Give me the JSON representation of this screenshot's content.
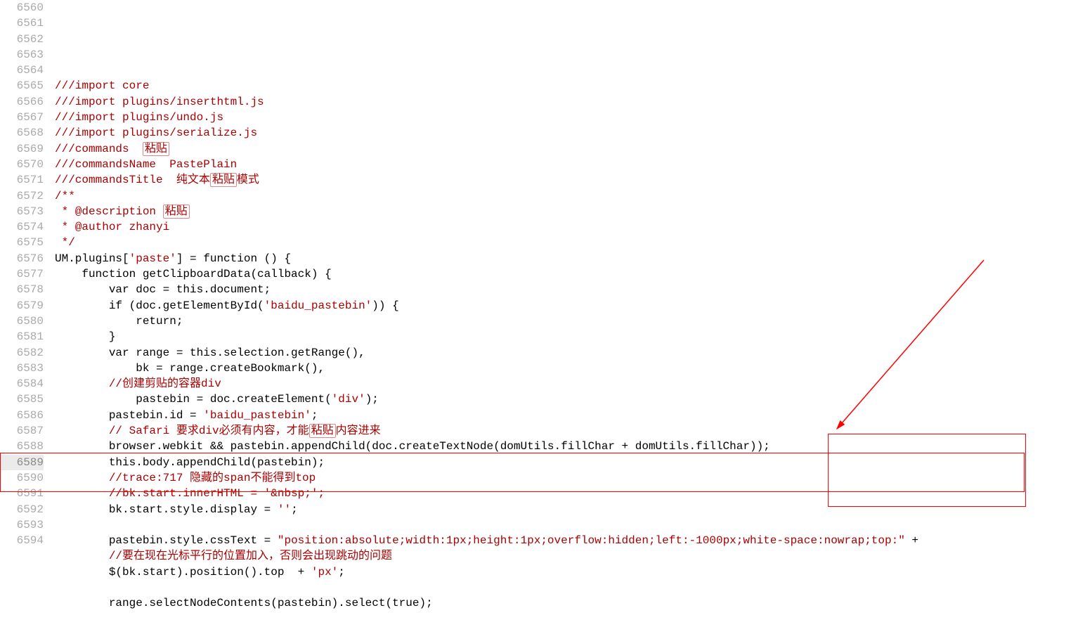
{
  "lines": [
    {
      "n": "6560",
      "t": "///import core",
      "cls": "c-com"
    },
    {
      "n": "6561",
      "t": "///import plugins/inserthtml.js",
      "cls": "c-com"
    },
    {
      "n": "6562",
      "t": "///import plugins/undo.js",
      "cls": "c-com"
    },
    {
      "n": "6563",
      "t": "///import plugins/serialize.js",
      "cls": "c-com"
    },
    {
      "n": "6564",
      "t": "///commands  ",
      "cls": "c-com",
      "suffix_boxed": "粘贴"
    },
    {
      "n": "6565",
      "t": "///commandsName  PastePlain",
      "cls": "c-com"
    },
    {
      "n": "6566",
      "t": "///commandsTitle  纯文本",
      "cls": "c-com",
      "suffix_boxed": "粘贴",
      "suffix_plain": "模式"
    },
    {
      "n": "6567",
      "t": "/**",
      "cls": "c-com"
    },
    {
      "n": "6568",
      "t": " * @description ",
      "cls": "c-com",
      "suffix_boxed": "粘贴"
    },
    {
      "n": "6569",
      "t": " * @author zhanyi",
      "cls": "c-com"
    },
    {
      "n": "6570",
      "t": " */",
      "cls": "c-com"
    },
    {
      "n": "6571",
      "code": "UM.plugins['paste'] = function () {"
    },
    {
      "n": "6572",
      "code": "    function getClipboardData(callback) {"
    },
    {
      "n": "6573",
      "code": "        var doc = this.document;"
    },
    {
      "n": "6574",
      "code": "        if (doc.getElementById('baidu_pastebin')) {"
    },
    {
      "n": "6575",
      "code": "            return;"
    },
    {
      "n": "6576",
      "code": "        }"
    },
    {
      "n": "6577",
      "code": "        var range = this.selection.getRange(),"
    },
    {
      "n": "6578",
      "code": "            bk = range.createBookmark(),"
    },
    {
      "n": "6579",
      "t": "        //创建剪贴的容器div",
      "cls": "c-com"
    },
    {
      "n": "6580",
      "code": "            pastebin = doc.createElement('div');"
    },
    {
      "n": "6581",
      "code": "        pastebin.id = 'baidu_pastebin';"
    },
    {
      "n": "6582",
      "t": "        // Safari 要求div必须有内容，才能",
      "cls": "c-com",
      "suffix_boxed": "粘贴",
      "suffix_plain": "内容进来"
    },
    {
      "n": "6583",
      "code": "        browser.webkit && pastebin.appendChild(doc.createTextNode(domUtils.fillChar + domUtils.fillChar));"
    },
    {
      "n": "6584",
      "code": "        this.body.appendChild(pastebin);"
    },
    {
      "n": "6585",
      "t": "        //trace:717 隐藏的span不能得到top",
      "cls": "c-com"
    },
    {
      "n": "6586",
      "t": "        //bk.start.innerHTML = '&nbsp;';",
      "cls": "c-com"
    },
    {
      "n": "6587",
      "code": "        bk.start.style.display = '';"
    },
    {
      "n": "6588",
      "code": ""
    },
    {
      "n": "6589",
      "code": "        pastebin.style.cssText = \"position:absolute;width:1px;height:1px;overflow:hidden;left:-1000px;white-space:nowrap;top:\" +",
      "cur": true
    },
    {
      "n": "6590",
      "t": "        //要在现在光标平行的位置加入，否则会出现跳动的问题",
      "cls": "c-com"
    },
    {
      "n": "6591",
      "code": "        $(bk.start).position().top  + 'px';"
    },
    {
      "n": "6592",
      "code": ""
    },
    {
      "n": "6593",
      "code": "        range.selectNodeContents(pastebin).select(true);"
    },
    {
      "n": "6594",
      "code": ""
    }
  ]
}
